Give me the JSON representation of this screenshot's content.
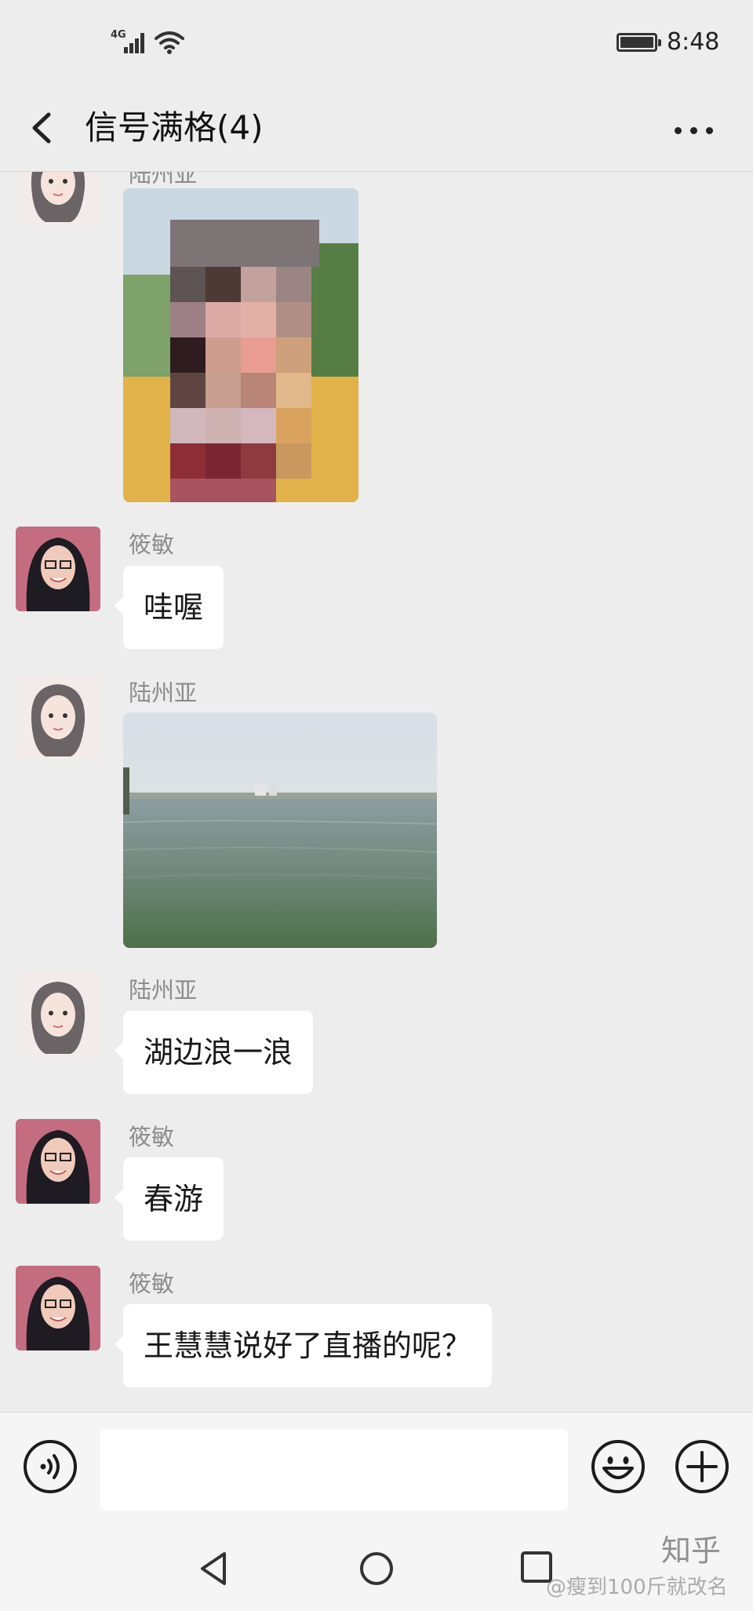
{
  "status_bar": {
    "network_label": "4G",
    "time": "8:48",
    "icons": [
      "signal-icon",
      "wifi-icon",
      "battery-icon"
    ]
  },
  "header": {
    "title": "信号满格(4)",
    "back_icon": "chevron-left-icon",
    "more_icon": "more-dots-icon"
  },
  "messages": [
    {
      "sender": "陆州亚",
      "type": "image",
      "content": "pixelated selfie photo"
    },
    {
      "sender": "筱敏",
      "type": "text",
      "text": "哇喔"
    },
    {
      "sender": "陆州亚",
      "type": "image",
      "content": "lake photo"
    },
    {
      "sender": "陆州亚",
      "type": "text",
      "text": "湖边浪一浪"
    },
    {
      "sender": "筱敏",
      "type": "text",
      "text": "春游"
    },
    {
      "sender": "筱敏",
      "type": "text",
      "text": "王慧慧说好了直播的呢？"
    }
  ],
  "input_bar": {
    "placeholder": "",
    "icons": [
      "voice-icon",
      "emoji-icon",
      "plus-icon"
    ]
  },
  "nav_bar": {
    "icons": [
      "nav-back-icon",
      "nav-home-icon",
      "nav-recent-icon"
    ],
    "watermark": "@瘦到100斤就改名",
    "brand_mark": "知乎"
  },
  "colors": {
    "background": "#ededed",
    "bubble": "#ffffff",
    "sender_name": "#8c8c8c",
    "bar": "#f5f5f5"
  }
}
